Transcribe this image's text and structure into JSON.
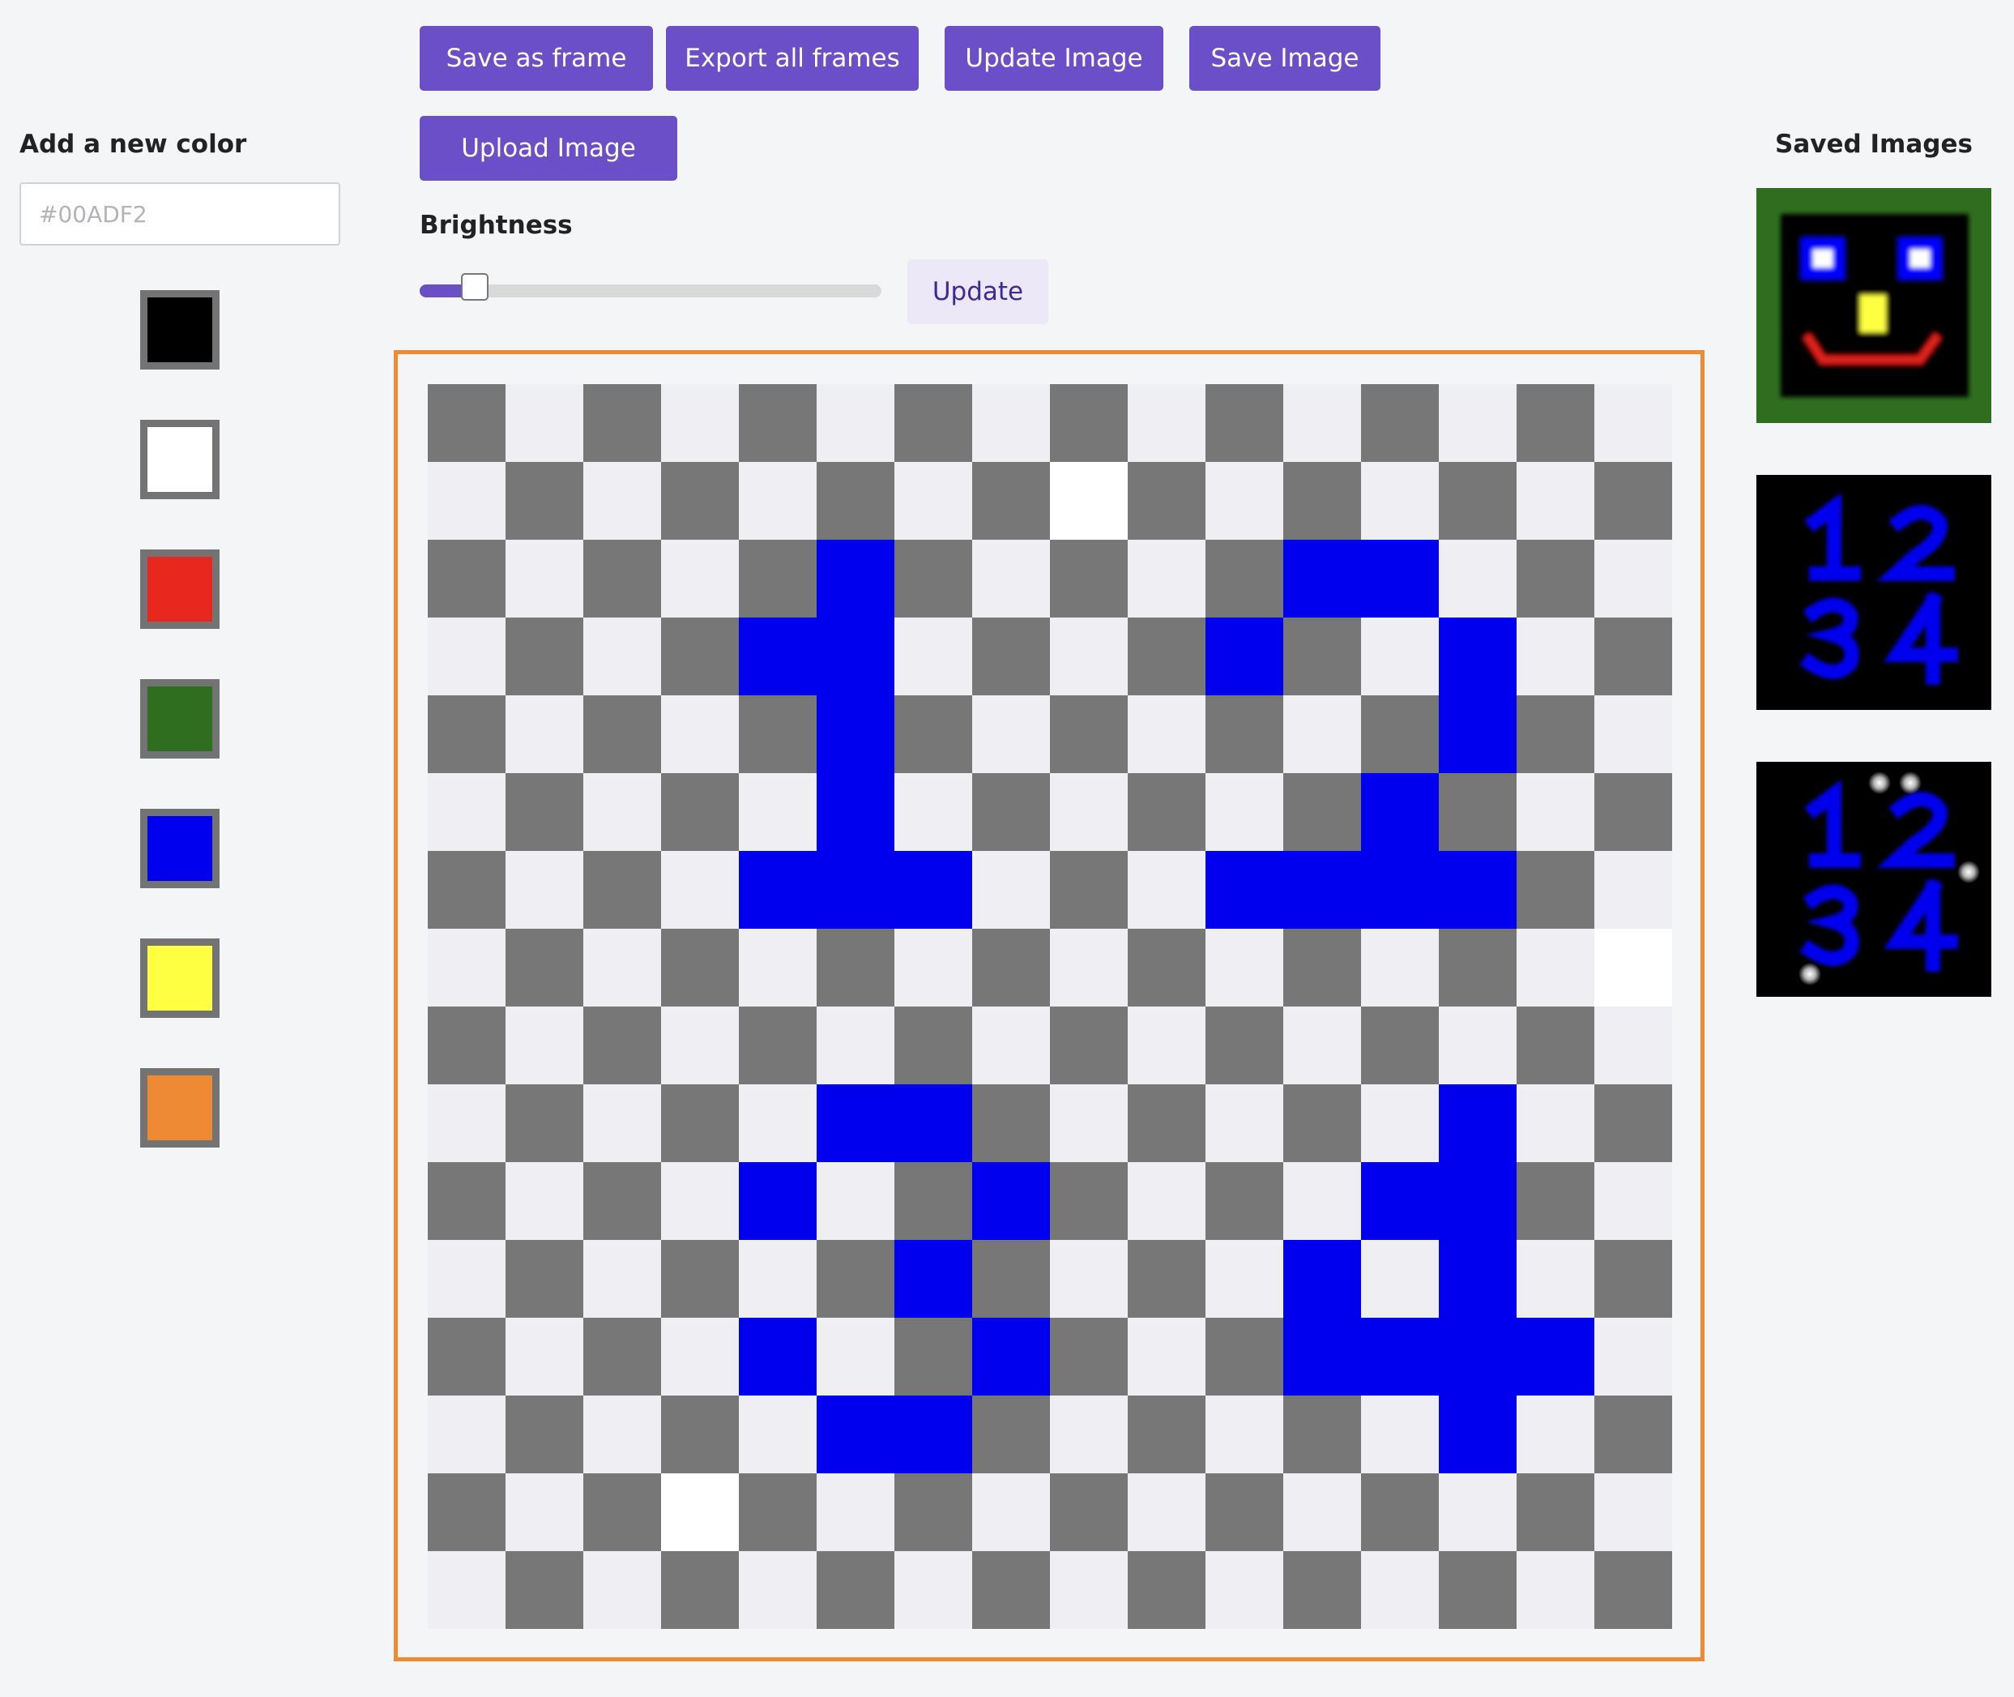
{
  "toolbar": {
    "save_frame": "Save as frame",
    "export_frames": "Export all frames",
    "update_image": "Update Image",
    "save_image": "Save Image",
    "upload_image": "Upload Image"
  },
  "left_panel": {
    "title": "Add a new color",
    "input_placeholder": "#00ADF2",
    "input_value": "",
    "swatches": [
      {
        "name": "black",
        "color": "#000000"
      },
      {
        "name": "white",
        "color": "#ffffff"
      },
      {
        "name": "red",
        "color": "#e8281f"
      },
      {
        "name": "green",
        "color": "#2f6e1f"
      },
      {
        "name": "blue",
        "color": "#0000ef"
      },
      {
        "name": "yellow",
        "color": "#ffff42"
      },
      {
        "name": "orange",
        "color": "#ee8a33"
      }
    ]
  },
  "brightness": {
    "label": "Brightness",
    "value_fraction": 0.12,
    "update_label": "Update"
  },
  "colors": {
    "accent": "#6b4fc8",
    "canvas_border": "#ee8a33",
    "checker_dark": "#777777",
    "checker_light": "#efeff3"
  },
  "pixel_canvas": {
    "size": 16,
    "palette": {
      "B": "#0000ef",
      "W": "#ffffff"
    },
    "rows": [
      "................",
      "........W.......",
      ".....B.....BB...",
      "....BB....B..B..",
      ".....B.......B..",
      ".....B......B...",
      "....BBB...BBBB..",
      "...............W",
      "................",
      ".....BB......B..",
      "....B..B....BB..",
      "......B....B.B..",
      "....B..B...BBBB.",
      ".....BB......B..",
      "...W............",
      "................"
    ]
  },
  "saved_images": {
    "title": "Saved Images",
    "thumbnails": [
      {
        "name": "smiley-face-thumbnail"
      },
      {
        "name": "numbers-1234-thumbnail"
      },
      {
        "name": "numbers-1234-sparkle-thumbnail"
      }
    ]
  }
}
